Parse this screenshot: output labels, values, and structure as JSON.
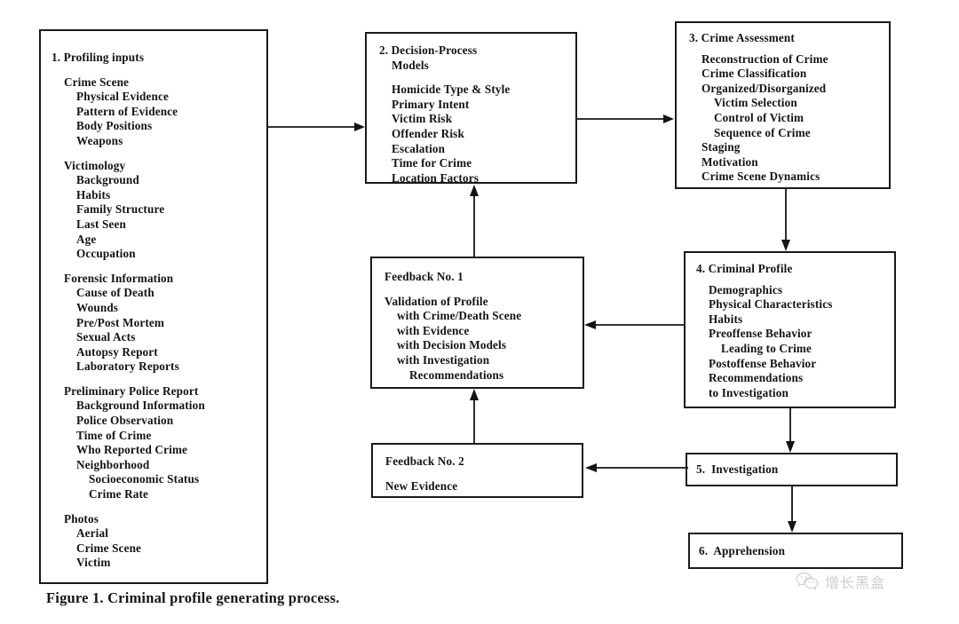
{
  "figure": {
    "caption": "Figure 1. Criminal profile generating process.",
    "title": "Criminal profile generating process"
  },
  "boxes": {
    "profiling_inputs": {
      "title": "1. Profiling inputs",
      "groups": [
        {
          "heading": "Crime Scene",
          "items": [
            "Physical Evidence",
            "Pattern of Evidence",
            "Body Positions",
            "Weapons"
          ]
        },
        {
          "heading": "Victimology",
          "items": [
            "Background",
            "Habits",
            "Family Structure",
            "Last Seen",
            "Age",
            "Occupation"
          ]
        },
        {
          "heading": "Forensic Information",
          "items": [
            "Cause of Death",
            "Wounds",
            "Pre/Post Mortem",
            "Sexual Acts",
            "Autopsy Report",
            "Laboratory Reports"
          ]
        },
        {
          "heading": "Preliminary Police Report",
          "items": [
            "Background Information",
            "Police Observation",
            "Time of Crime",
            "Who Reported Crime",
            "Neighborhood"
          ],
          "subitems": [
            "Socioeconomic Status",
            "Crime Rate"
          ]
        },
        {
          "heading": "Photos",
          "items": [
            "Aerial",
            "Crime Scene",
            "Victim"
          ]
        }
      ]
    },
    "decision_process": {
      "title_line1": "2. Decision-Process",
      "title_line2": "Models",
      "items": [
        "Homicide Type & Style",
        "Primary Intent",
        "Victim Risk",
        "Offender Risk",
        "Escalation",
        "Time for Crime",
        "Location Factors"
      ]
    },
    "crime_assessment": {
      "title": "3. Crime Assessment",
      "items": [
        "Reconstruction of Crime",
        "Crime Classification",
        "Organized/Disorganized"
      ],
      "subitems": [
        "Victim Selection",
        "Control of Victim",
        "Sequence of Crime"
      ],
      "items_tail": [
        "Staging",
        "Motivation",
        "Crime Scene Dynamics"
      ]
    },
    "criminal_profile": {
      "title": "4. Criminal Profile",
      "items": [
        "Demographics",
        "Physical Characteristics",
        "Habits",
        "Preoffense Behavior"
      ],
      "indented": "Leading to Crime",
      "items_tail": [
        "Postoffense Behavior",
        "Recommendations",
        "to Investigation"
      ]
    },
    "feedback_one": {
      "title": "Feedback No. 1",
      "subtitle": "Validation of Profile",
      "items": [
        "with Crime/Death Scene",
        "with Evidence",
        "with Decision Models",
        "with Investigation"
      ],
      "indented": "Recommendations"
    },
    "feedback_two": {
      "title": "Feedback No. 2",
      "body": "New Evidence"
    },
    "investigation": {
      "title": "5.  Investigation"
    },
    "apprehension": {
      "title": "6.  Apprehension"
    }
  },
  "arrows": [
    {
      "name": "profiling-to-decision",
      "direction": "right"
    },
    {
      "name": "decision-to-assessment",
      "direction": "right"
    },
    {
      "name": "assessment-to-profile",
      "direction": "down"
    },
    {
      "name": "profile-to-feedback-one",
      "direction": "left"
    },
    {
      "name": "profile-to-investigation",
      "direction": "down"
    },
    {
      "name": "investigation-to-feedback-two",
      "direction": "left"
    },
    {
      "name": "feedback-two-to-feedback-one",
      "direction": "up"
    },
    {
      "name": "feedback-one-to-decision",
      "direction": "up"
    },
    {
      "name": "investigation-to-apprehension",
      "direction": "down"
    }
  ],
  "watermark": {
    "text": "增长黑盒",
    "icon": "wechat-icon"
  },
  "colors": {
    "ink": "#141414",
    "page": "#ffffff",
    "watermark": "#8a8a8a"
  }
}
